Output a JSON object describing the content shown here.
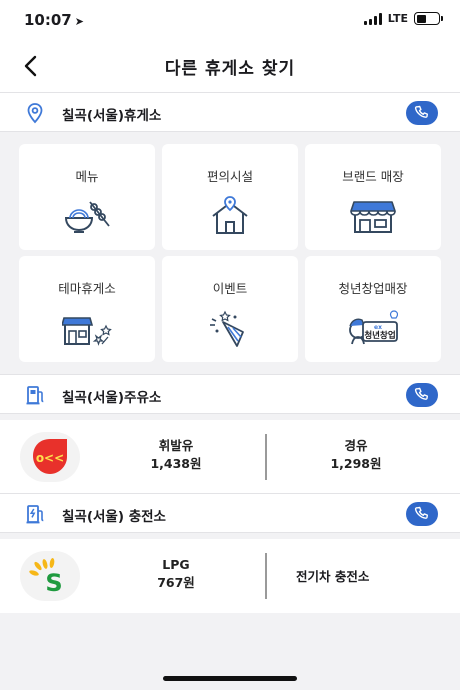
{
  "status_bar": {
    "time": "10:07",
    "network": "LTE",
    "battery_level": 0.45
  },
  "header": {
    "title": "다른 휴게소 찾기"
  },
  "rest_area": {
    "name": "칠곡(서울)휴게소",
    "categories": [
      {
        "label": "메뉴",
        "icon": "food-bowl-icon"
      },
      {
        "label": "편의시설",
        "icon": "house-pin-icon"
      },
      {
        "label": "브랜드 매장",
        "icon": "storefront-icon"
      },
      {
        "label": "테마휴게소",
        "icon": "themed-store-icon"
      },
      {
        "label": "이벤트",
        "icon": "party-popper-icon"
      },
      {
        "label": "청년창업매장",
        "icon": "youth-startup-icon",
        "badge_text": "청년창업",
        "badge_small": "ex"
      }
    ]
  },
  "gas_station": {
    "name": "칠곡(서울)주유소",
    "gasoline": {
      "label": "휘발유",
      "price": "1,438원"
    },
    "diesel": {
      "label": "경유",
      "price": "1,298원"
    },
    "logo_text": "o<<",
    "logo_color": "#e8312b"
  },
  "charging_station": {
    "name": "칠곡(서울) 충전소",
    "lpg": {
      "label": "LPG",
      "price": "767원"
    },
    "ev_label": "전기차 충전소",
    "logo_text": "S",
    "logo_color": "#1f9a3f"
  },
  "colors": {
    "accent": "#2f67c9",
    "background": "#f2f2f4",
    "icon_stroke": "#34485f",
    "icon_highlight": "#3f79d8"
  }
}
